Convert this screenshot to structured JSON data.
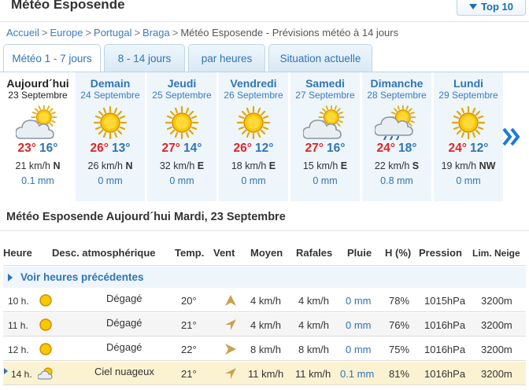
{
  "header": {
    "title": "Météo Esposende",
    "top10_label": "Top 10"
  },
  "breadcrumb": {
    "items": [
      "Accueil",
      "Europe",
      "Portugal",
      "Braga"
    ],
    "separator": ">",
    "current": "Météo Esposende - Prévisions météo à 14 jours"
  },
  "tabs": [
    "Météo 1 - 7 jours",
    "8 - 14 jours",
    "par heures",
    "Situation actuelle"
  ],
  "days": [
    {
      "name": "Aujourd´hui",
      "date": "23 Septembre",
      "icon": "sun-cloud-icon",
      "max": "23°",
      "min": "16°",
      "wind_speed": "21 km/h",
      "wind_dir": "N",
      "rain": "0.1 mm"
    },
    {
      "name": "Demain",
      "date": "24 Septembre",
      "icon": "sun-icon",
      "max": "26°",
      "min": "13°",
      "wind_speed": "26 km/h",
      "wind_dir": "N",
      "rain": "0 mm"
    },
    {
      "name": "Jeudi",
      "date": "25 Septembre",
      "icon": "sun-icon",
      "max": "27°",
      "min": "14°",
      "wind_speed": "32 km/h",
      "wind_dir": "E",
      "rain": "0 mm"
    },
    {
      "name": "Vendredi",
      "date": "26 Septembre",
      "icon": "sun-icon",
      "max": "26°",
      "min": "12°",
      "wind_speed": "18 km/h",
      "wind_dir": "E",
      "rain": "0 mm"
    },
    {
      "name": "Samedi",
      "date": "27 Septembre",
      "icon": "sun-cloud-icon",
      "max": "27°",
      "min": "16°",
      "wind_speed": "15 km/h",
      "wind_dir": "E",
      "rain": "0 mm"
    },
    {
      "name": "Dimanche",
      "date": "28 Septembre",
      "icon": "rain-shower-icon",
      "max": "24°",
      "min": "18°",
      "wind_speed": "22 km/h",
      "wind_dir": "S",
      "rain": "0.8 mm"
    },
    {
      "name": "Lundi",
      "date": "29 Septembre",
      "icon": "sun-icon",
      "max": "24°",
      "min": "12°",
      "wind_speed": "19 km/h",
      "wind_dir": "NW",
      "rain": "0 mm"
    }
  ],
  "section_title": "Météo Esposende Aujourd´hui Mardi, 23 Septembre",
  "table": {
    "headers": [
      "Heure",
      "Desc. atmosphérique",
      "Temp.",
      "Vent",
      "Moyen",
      "Rafales",
      "Pluie",
      "H (%)",
      "Pression",
      "Lim. Neige"
    ],
    "prev_label": "Voir heures précédentes",
    "rows": [
      {
        "hour": "10 h.",
        "icon": "sun-icon",
        "desc": "Dégagé",
        "temp": "20°",
        "wind_icon": "wind-arrow-icon",
        "avg": "4 km/h",
        "gust": "4 km/h",
        "rain": "0 mm",
        "hum": "78%",
        "press": "1015hPa",
        "snow": "3200m"
      },
      {
        "hour": "11 h.",
        "icon": "sun-icon",
        "desc": "Dégagé",
        "temp": "21°",
        "wind_icon": "wind-arrow-icon",
        "avg": "4 km/h",
        "gust": "4 km/h",
        "rain": "0 mm",
        "hum": "76%",
        "press": "1016hPa",
        "snow": "3200m"
      },
      {
        "hour": "12 h.",
        "icon": "sun-icon",
        "desc": "Dégagé",
        "temp": "22°",
        "wind_icon": "wind-arrow-icon",
        "avg": "8 km/h",
        "gust": "8 km/h",
        "rain": "0 mm",
        "hum": "75%",
        "press": "1016hPa",
        "snow": "3200m"
      },
      {
        "hour": "14 h.",
        "icon": "sun-cloud-icon",
        "desc": "Ciel nuageux",
        "temp": "21°",
        "wind_icon": "wind-arrow-icon",
        "avg": "11 km/h",
        "gust": "11 km/h",
        "rain": "0.1 mm",
        "hum": "81%",
        "press": "1016hPa",
        "snow": "3200m"
      }
    ]
  },
  "colors": {
    "accent": "#2e75b6",
    "max_temp": "#e02525",
    "current_row": "#fbf2d2"
  }
}
